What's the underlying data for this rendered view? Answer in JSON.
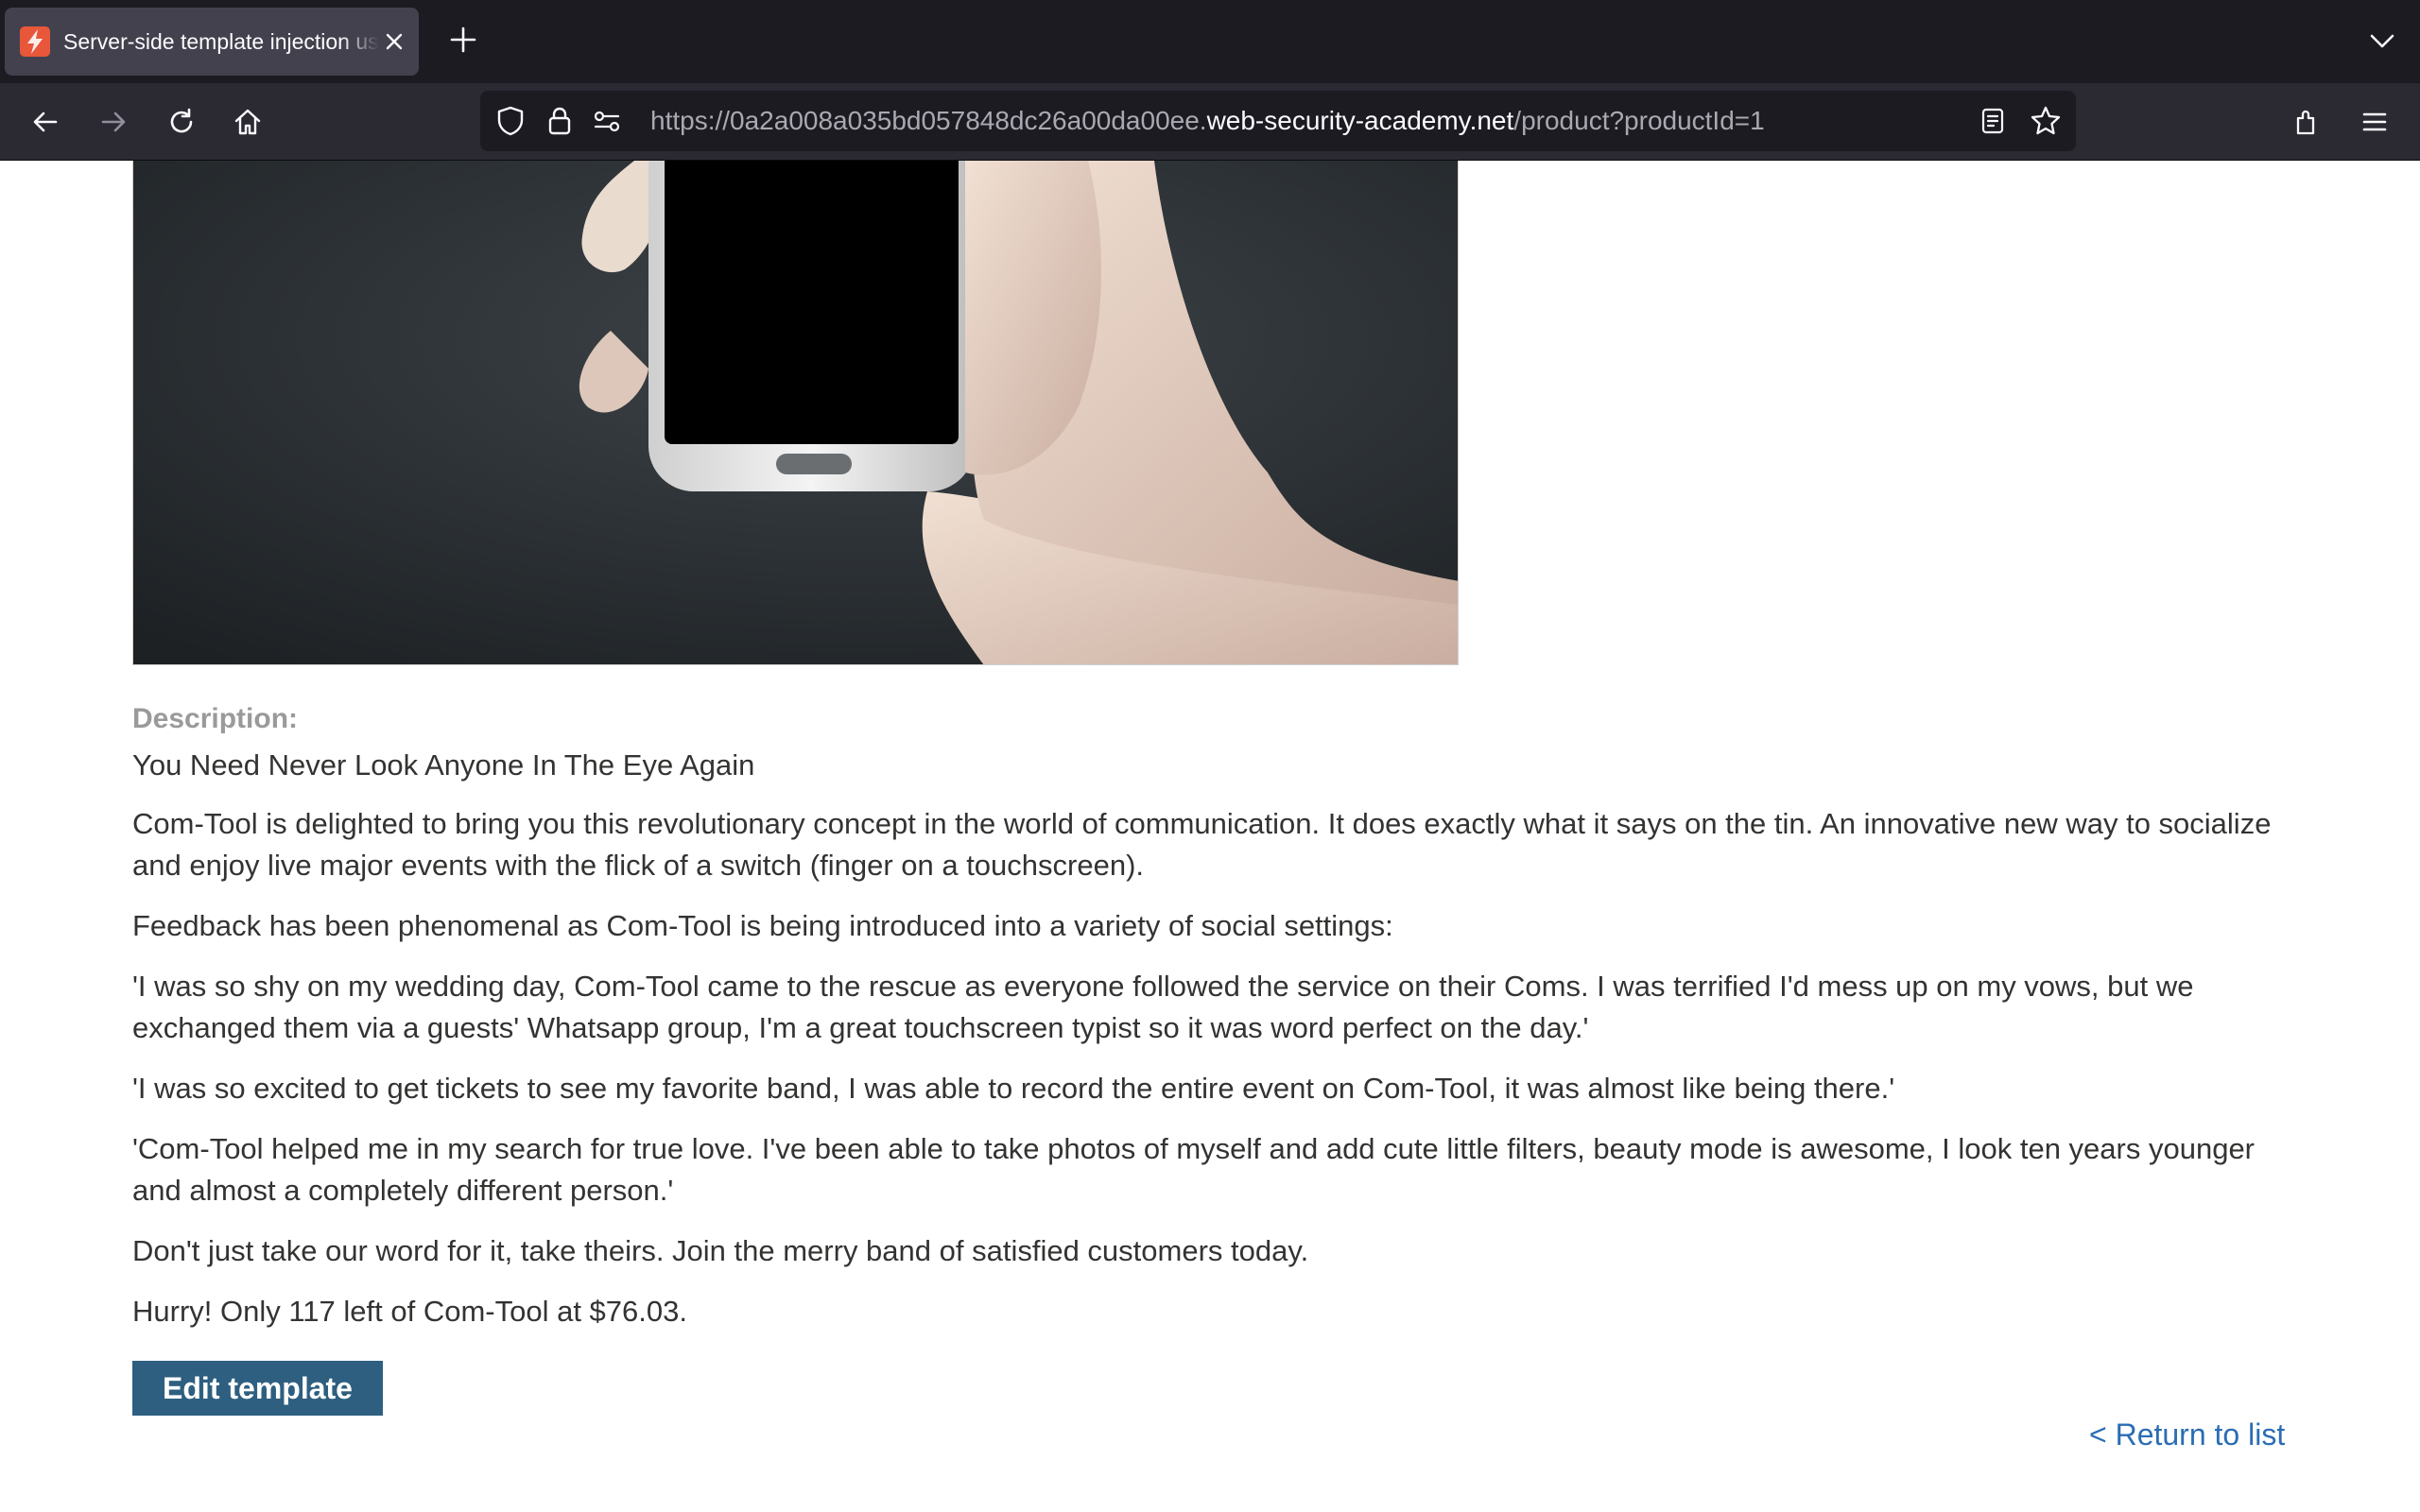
{
  "browser": {
    "tab": {
      "title": "Server-side template injection using documentation",
      "favicon": "portswigger-bolt-icon",
      "favicon_color": "#e8573a"
    },
    "url": {
      "scheme_prefix": "https://0a2a008a035bd057848dc26a00da00ee.",
      "host": "web-security-academy.net",
      "path": "/product?productId=1"
    },
    "colors": {
      "tabstrip_bg": "#1c1b22",
      "toolbar_bg": "#2b2a33",
      "active_tab_bg": "#42414d"
    }
  },
  "product": {
    "image_description_icon": "phone-in-hand-image",
    "description_label": "Description:",
    "title": "You Need Never Look Anyone In The Eye Again",
    "paragraphs": [
      "Com-Tool is delighted to bring you this revolutionary concept in the world of communication. It does exactly what it says on the tin. An innovative new way to socialize and enjoy live major events with the flick of a switch (finger on a touchscreen).",
      "Feedback has been phenomenal as Com-Tool is being introduced into a variety of social settings:",
      "'I was so shy on my wedding day, Com-Tool came to the rescue as everyone followed the service on their Coms. I was terrified I'd mess up on my vows, but we exchanged them via a guests' Whatsapp group, I'm a great touchscreen typist so it was word perfect on the day.'",
      "'I was so excited to get tickets to see my favorite band, I was able to record the entire event on Com-Tool, it was almost like being there.'",
      "'Com-Tool helped me in my search for true love. I've been able to take photos of myself and add cute little filters, beauty mode is awesome, I look ten years younger and almost a completely different person.'",
      "Don't just take our word for it, take theirs. Join the merry band of satisfied customers today.",
      "Hurry! Only 117 left of Com-Tool at $76.03."
    ]
  },
  "actions": {
    "edit_template": "Edit template",
    "return_to_list": "< Return to list",
    "button_color": "#2e5f80",
    "link_color": "#2a6db4"
  }
}
